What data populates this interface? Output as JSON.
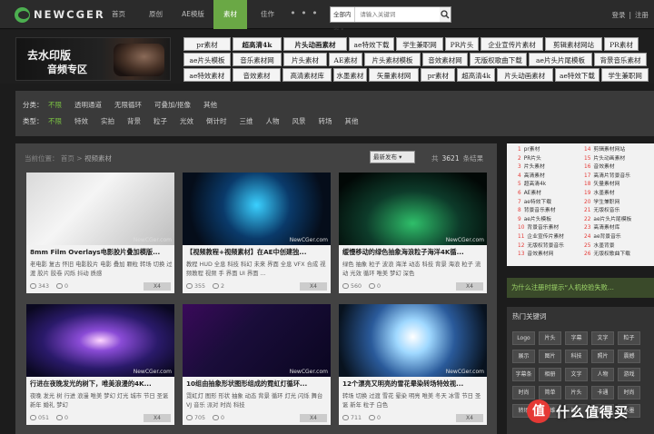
{
  "brand": {
    "name": "NEWCGER"
  },
  "nav": [
    "首页",
    "原创",
    "AE模版",
    "素材",
    "佳作"
  ],
  "nav_more": "• • •",
  "search": {
    "category": "全部内容",
    "placeholder": "请输入关键词"
  },
  "auth": {
    "login": "登录",
    "sep": "|",
    "register": "注册"
  },
  "promo": {
    "line1": "去水印版",
    "line2": "音频专区"
  },
  "tag_rows": [
    [
      "pr素材",
      "超高清4k",
      "片头动画素材",
      "ae特效下载",
      "学生兼职网",
      "PR片头",
      "企业宣传片素材",
      "剪辑素材网站",
      "PR素材"
    ],
    [
      "ae片头模板",
      "音乐素材网",
      "片头素材",
      "AE素材",
      "片头素材模板",
      "音效素材网",
      "无版权歌曲下载",
      "ae片头片尾模板",
      "背景音乐素材"
    ],
    [
      "ae特效素材",
      "音效素材",
      "高清素材库",
      "水墨素材",
      "矢量素材网",
      "pr素材",
      "超高清4k",
      "片头动画素材",
      "ae特效下载",
      "学生兼职网"
    ]
  ],
  "filters": {
    "category_label": "分类：",
    "categories": [
      "不限",
      "透明通道",
      "无限循环",
      "可叠加/抠像",
      "其他"
    ],
    "type_label": "类型：",
    "types": [
      "不限",
      "特效",
      "实拍",
      "背景",
      "粒子",
      "光效",
      "倒计时",
      "三维",
      "人物",
      "风景",
      "转场",
      "其他"
    ]
  },
  "breadcrumb": {
    "label": "当前位置：",
    "home": "首页",
    "sep": ">",
    "current": "视频素材"
  },
  "sort": "最新发布 ▾",
  "count": {
    "prefix": "共",
    "value": "3621",
    "suffix": "条结果"
  },
  "cards": [
    {
      "title": "8mm Film Overlays电影胶片叠加模版...",
      "tags": "老电影 复古 怀旧 电影胶片 电影 叠加 颗粒 转场 切换 过渡 胶片 胶卷 闪烁 抖动 质感",
      "views": "343",
      "likes": "0",
      "btn": "X4",
      "watermark": "NewCGer.com"
    },
    {
      "title": "【视频教程+视频素材】在AE中创建独...",
      "tags": "教程 HUD 全息 科技 科幻 未来 界面 全息 VFX 合成 视频教程 视频 手 界面 UI 界面 ...",
      "views": "355",
      "likes": "2",
      "btn": "X4",
      "watermark": "NewCGer.com"
    },
    {
      "title": "缓慢移动的绿色抽象海浪粒子海洋4K循...",
      "tags": "绿色 抽象 粒子 波浪 海洋 动态 科技 背景 海浪 粒子 流动 光效 循环 唯美 梦幻 深色",
      "views": "560",
      "likes": "0",
      "btn": "X4",
      "watermark": "NewCGer.com"
    },
    {
      "title": "行进在夜晚发光的树下，唯美浪漫的4K...",
      "tags": "夜晚 发光 树 行进 浪漫 唯美 梦幻 灯光 城市 节日 圣诞 新年 婚礼 梦幻",
      "views": "051",
      "likes": "0",
      "btn": "X4",
      "watermark": "NewCGer.com"
    },
    {
      "title": "10组由抽象形状图形组成的霓虹灯循环...",
      "tags": "霓虹灯 图形 形状 抽象 动态 背景 循环 灯光 闪烁 舞台 VJ 音乐 派对 时尚 科技",
      "views": "705",
      "likes": "0",
      "btn": "X4",
      "watermark": "NewCGer.com"
    },
    {
      "title": "12个漂亮又明亮的雪花晕染转场特效视...",
      "tags": "转场 切换 过渡 雪花 晕染 明亮 唯美 冬天 冰雪 节日 圣诞 新年 粒子 白色",
      "views": "711",
      "likes": "0",
      "btn": "X4",
      "watermark": "NewCGer.com"
    }
  ],
  "rank_left": [
    {
      "n": "1",
      "t": "pr素材"
    },
    {
      "n": "2",
      "t": "PR片头"
    },
    {
      "n": "3",
      "t": "片头素材"
    },
    {
      "n": "4",
      "t": "高清素材"
    },
    {
      "n": "5",
      "t": "超高清4k"
    },
    {
      "n": "6",
      "t": "AE素材"
    },
    {
      "n": "7",
      "t": "ae特效下载"
    },
    {
      "n": "8",
      "t": "背景音乐素材"
    },
    {
      "n": "9",
      "t": "ae片头模板"
    },
    {
      "n": "10",
      "t": "背景音乐素材"
    },
    {
      "n": "11",
      "t": "企业宣传片素材"
    },
    {
      "n": "12",
      "t": "无版权背景音乐"
    },
    {
      "n": "13",
      "t": "音效素材网"
    }
  ],
  "rank_right": [
    {
      "n": "14",
      "t": "剪辑素材网站"
    },
    {
      "n": "15",
      "t": "片头动画素材"
    },
    {
      "n": "16",
      "t": "音效素材"
    },
    {
      "n": "17",
      "t": "高清片背景音乐"
    },
    {
      "n": "18",
      "t": "矢量素材网"
    },
    {
      "n": "19",
      "t": "水墨素材"
    },
    {
      "n": "20",
      "t": "学生兼职网"
    },
    {
      "n": "21",
      "t": "无版权音乐"
    },
    {
      "n": "22",
      "t": "ae片头片尾模板"
    },
    {
      "n": "23",
      "t": "高清素材库"
    },
    {
      "n": "24",
      "t": "ae背景音乐"
    },
    {
      "n": "25",
      "t": "水墨背景"
    },
    {
      "n": "26",
      "t": "无版权歌曲下载"
    }
  ],
  "ad_text": "为什么注册时提示“人机校验失败...",
  "hot": {
    "title": "热门关键词",
    "keywords": [
      "Logo",
      "片头",
      "字幕",
      "文字",
      "粒子",
      "展示",
      "图片",
      "科技",
      "照片",
      "震撼",
      "字幕条",
      "相册",
      "文字",
      "人物",
      "游戏",
      "时尚",
      "简单",
      "片头",
      "卡通",
      "时尚",
      "转场",
      "三维",
      "循环",
      "地球",
      "水墨"
    ]
  },
  "watermark_logo": {
    "mark": "值",
    "text": "什么值得买"
  }
}
